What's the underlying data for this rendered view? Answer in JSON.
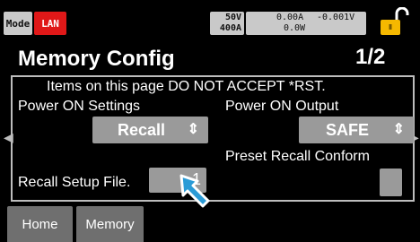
{
  "status": {
    "mode": "Mode",
    "lan": "LAN",
    "voltage_range": "50V",
    "current_range": "400A",
    "measured_current": "0.00A",
    "measured_voltage": "-0.001V",
    "measured_power": "0.0W"
  },
  "header": {
    "title": "Memory Config",
    "page": "1/2"
  },
  "panel": {
    "notice": "Items on this page DO NOT ACCEPT *RST.",
    "power_on_settings": {
      "label": "Power ON Settings",
      "value": "Recall"
    },
    "power_on_output": {
      "label": "Power ON Output",
      "value": "SAFE"
    },
    "preset_recall_confirm": {
      "label": "Preset Recall Conform"
    },
    "recall_setup_file": {
      "label": "Recall Setup File.",
      "value": "1"
    }
  },
  "tabs": [
    "Home",
    "Memory"
  ],
  "colors": {
    "alert_red": "#e01818",
    "lock_yellow": "#f5b800",
    "cursor_blue": "#2b9bd6"
  }
}
